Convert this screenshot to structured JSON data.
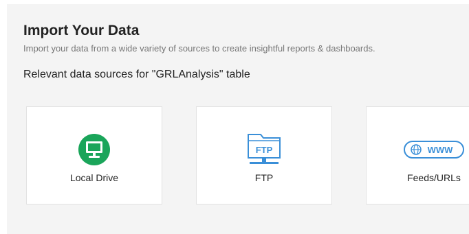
{
  "header": {
    "title": "Import Your Data",
    "subtitle": "Import your data from a wide variety of sources to create insightful reports & dashboards."
  },
  "section": {
    "label": "Relevant data sources for \"GRLAnalysis\" table"
  },
  "sources": [
    {
      "label": "Local Drive",
      "icon": "monitor-icon",
      "icon_color": "#1aa55a"
    },
    {
      "label": "FTP",
      "icon": "ftp-folder-icon",
      "icon_color": "#3a8fd8",
      "icon_text": "FTP"
    },
    {
      "label": "Feeds/URLs",
      "icon": "www-globe-icon",
      "icon_color": "#3a8fd8",
      "icon_text": "WWW"
    }
  ]
}
